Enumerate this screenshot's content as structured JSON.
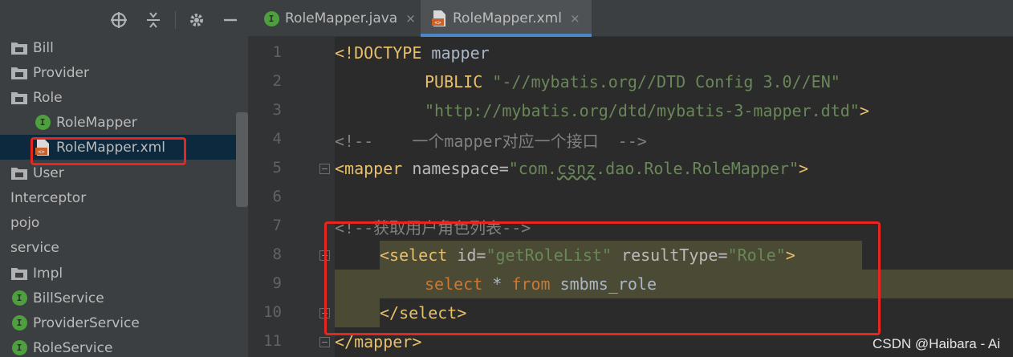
{
  "toolbar": {
    "icons": [
      "crosshair-icon",
      "collapse-icon",
      "gear-icon",
      "minimize-icon"
    ]
  },
  "tree": [
    {
      "label": "Bill",
      "kind": "folder"
    },
    {
      "label": "Provider",
      "kind": "folder"
    },
    {
      "label": "Role",
      "kind": "folder"
    },
    {
      "label": "RoleMapper",
      "kind": "interface"
    },
    {
      "label": "RoleMapper.xml",
      "kind": "xml",
      "selected": true
    },
    {
      "label": "User",
      "kind": "folder"
    },
    {
      "label": "Interceptor",
      "kind": "package"
    },
    {
      "label": "pojo",
      "kind": "package"
    },
    {
      "label": "service",
      "kind": "package"
    },
    {
      "label": "Impl",
      "kind": "folder"
    },
    {
      "label": "BillService",
      "kind": "interface"
    },
    {
      "label": "ProviderService",
      "kind": "interface"
    },
    {
      "label": "RoleService",
      "kind": "interface"
    }
  ],
  "tabs": [
    {
      "label": "RoleMapper.java",
      "icon": "interface-icon",
      "active": false
    },
    {
      "label": "RoleMapper.xml",
      "icon": "xml-icon",
      "active": true
    }
  ],
  "tab_close": "×",
  "line_numbers": [
    "1",
    "2",
    "3",
    "4",
    "5",
    "6",
    "7",
    "8",
    "9",
    "10",
    "11"
  ],
  "code": {
    "l1_open": "<!DOCTYPE",
    "l1_rest": " mapper",
    "l2_kw": "PUBLIC",
    "l2_str": "\"-//mybatis.org//DTD Config 3.0//EN\"",
    "l3_str": "\"http://mybatis.org/dtd/mybatis-3-mapper.dtd\"",
    "l3_close": ">",
    "l4_comment": "<!--    一个mapper对应一个接口  -->",
    "l5_open": "<mapper",
    "l5_attr": " namespace=",
    "l5_q1": "\"com.",
    "l5_sq": "csnz",
    "l5_q2": ".dao.Role.RoleMapper\"",
    "l5_close": ">",
    "l7_comment": "<!--获取用户角色列表-->",
    "l8_open": "<select",
    "l8_attr1": " id=",
    "l8_val1": "\"getRoleList\"",
    "l8_attr2": " resultType=",
    "l8_val2": "\"Role\"",
    "l8_close": ">",
    "l9_kw1": "select",
    "l9_mid": " * ",
    "l9_kw2": "from",
    "l9_rest": " smbms_role",
    "l10_close": "</select>",
    "l11_close": "</mapper>"
  },
  "watermark": "CSDN @Haibara - Ai",
  "colors": {
    "highlight_box": "#e8251e",
    "tab_underline": "#4a88c7",
    "selection": "#0d293e"
  }
}
